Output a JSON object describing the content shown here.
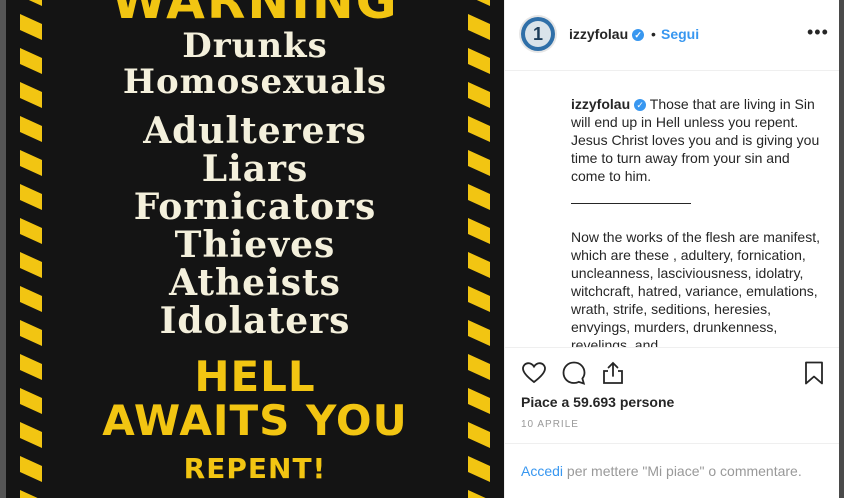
{
  "poster": {
    "title": "WARNING",
    "sinners": [
      "Drunks",
      "Homosexuals",
      "Adulterers",
      "Liars",
      "Fornicators",
      "Thieves",
      "Atheists",
      "Idolaters"
    ],
    "headline_line1": "HELL",
    "headline_line2": "AWAITS YOU",
    "call": "REPENT!",
    "colors": {
      "stripe_yellow": "#f2c512",
      "stripe_black": "#141414",
      "text_cream": "#f4f0dc",
      "text_yellow": "#f2c512"
    }
  },
  "header": {
    "username": "izzyfolau",
    "separator": "•",
    "follow_label": "Segui",
    "avatar_glyph": "1",
    "more_glyph": "•••"
  },
  "caption": {
    "username": "izzyfolau",
    "paragraph1": "Those that are living in Sin will end up in Hell unless you repent. Jesus Christ loves you and is giving you time to turn away from your sin and come to him.",
    "paragraph2": "Now the works of the flesh are manifest, which are these , adultery, fornication, uncleanness, lasciviousness, idolatry, witchcraft, hatred, variance, emulations, wrath, strife, seditions, heresies, envyings, murders, drunkenness, revelings, and"
  },
  "actions": {
    "icons": [
      "heart-icon",
      "comment-icon",
      "share-icon",
      "bookmark-icon"
    ],
    "likes_text": "Piace a 59.693 persone",
    "date": "10 APRILE"
  },
  "footer": {
    "login_link": "Accedi",
    "login_rest": " per mettere \"Mi piace\" o commentare."
  },
  "colors": {
    "accent": "#3897f0",
    "text": "#262626",
    "muted": "#999999"
  }
}
